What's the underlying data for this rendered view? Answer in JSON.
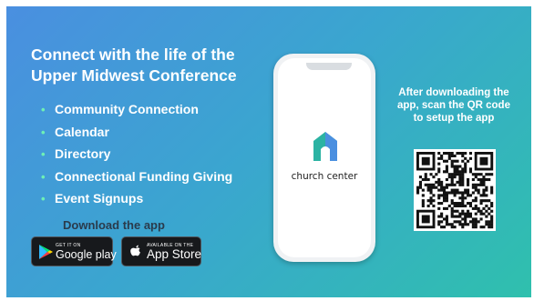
{
  "headline": "Connect with the life of the Upper Midwest Conference",
  "features": [
    "Community Connection",
    "Calendar",
    "Directory",
    "Connectional Funding Giving",
    "Event Signups"
  ],
  "download_label": "Download the app",
  "google_play": {
    "small": "GET IT ON",
    "big": "Google play"
  },
  "app_store": {
    "small": "AVAILABLE ON THE",
    "big": "App Store"
  },
  "app_name": "church center",
  "qr_instructions": "After downloading the app, scan the QR code to setup the app",
  "colors": {
    "gradient_start": "#4a8fe0",
    "gradient_end": "#2fc0ad",
    "bullet": "#6ef0b5",
    "download_label": "#2a3b4c",
    "logo_teal": "#2bb3a3",
    "logo_blue": "#4a8fe0"
  },
  "icons": [
    "google-play-icon",
    "apple-icon",
    "church-center-logo-icon",
    "qr-code-icon"
  ]
}
